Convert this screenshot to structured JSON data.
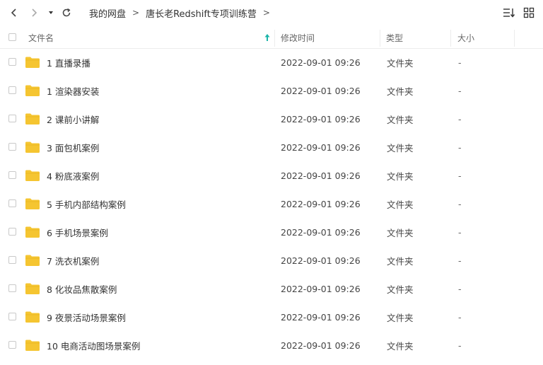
{
  "breadcrumb": {
    "items": [
      "我的网盘",
      "唐长老Redshift专项训练营"
    ],
    "separator": ">"
  },
  "header": {
    "name": "文件名",
    "modified": "修改时间",
    "type": "类型",
    "size": "大小",
    "sort_icon": "sort-ascending-arrow-icon"
  },
  "icons": {
    "back": "back-chevron-icon",
    "forward": "forward-chevron-icon",
    "dropdown": "dropdown-caret-icon",
    "refresh": "refresh-icon",
    "sort_view": "sort-list-icon",
    "grid_view": "grid-view-icon",
    "folder": "folder-icon"
  },
  "colors": {
    "folder": "#F5C531",
    "accent": "#1CB5A9"
  },
  "files": [
    {
      "name": "1  直播录播",
      "modified": "2022-09-01 09:26",
      "type": "文件夹",
      "size": "-"
    },
    {
      "name": "1 渲染器安装",
      "modified": "2022-09-01 09:26",
      "type": "文件夹",
      "size": "-"
    },
    {
      "name": "2 课前小讲解",
      "modified": "2022-09-01 09:26",
      "type": "文件夹",
      "size": "-"
    },
    {
      "name": "3 面包机案例",
      "modified": "2022-09-01 09:26",
      "type": "文件夹",
      "size": "-"
    },
    {
      "name": "4 粉底液案例",
      "modified": "2022-09-01 09:26",
      "type": "文件夹",
      "size": "-"
    },
    {
      "name": "5 手机内部结构案例",
      "modified": "2022-09-01 09:26",
      "type": "文件夹",
      "size": "-"
    },
    {
      "name": "6 手机场景案例",
      "modified": "2022-09-01 09:26",
      "type": "文件夹",
      "size": "-"
    },
    {
      "name": "7 洗衣机案例",
      "modified": "2022-09-01 09:26",
      "type": "文件夹",
      "size": "-"
    },
    {
      "name": "8 化妆品焦散案例",
      "modified": "2022-09-01 09:26",
      "type": "文件夹",
      "size": "-"
    },
    {
      "name": "9 夜景活动场景案例",
      "modified": "2022-09-01 09:26",
      "type": "文件夹",
      "size": "-"
    },
    {
      "name": "10 电商活动图场景案例",
      "modified": "2022-09-01 09:26",
      "type": "文件夹",
      "size": "-"
    }
  ]
}
